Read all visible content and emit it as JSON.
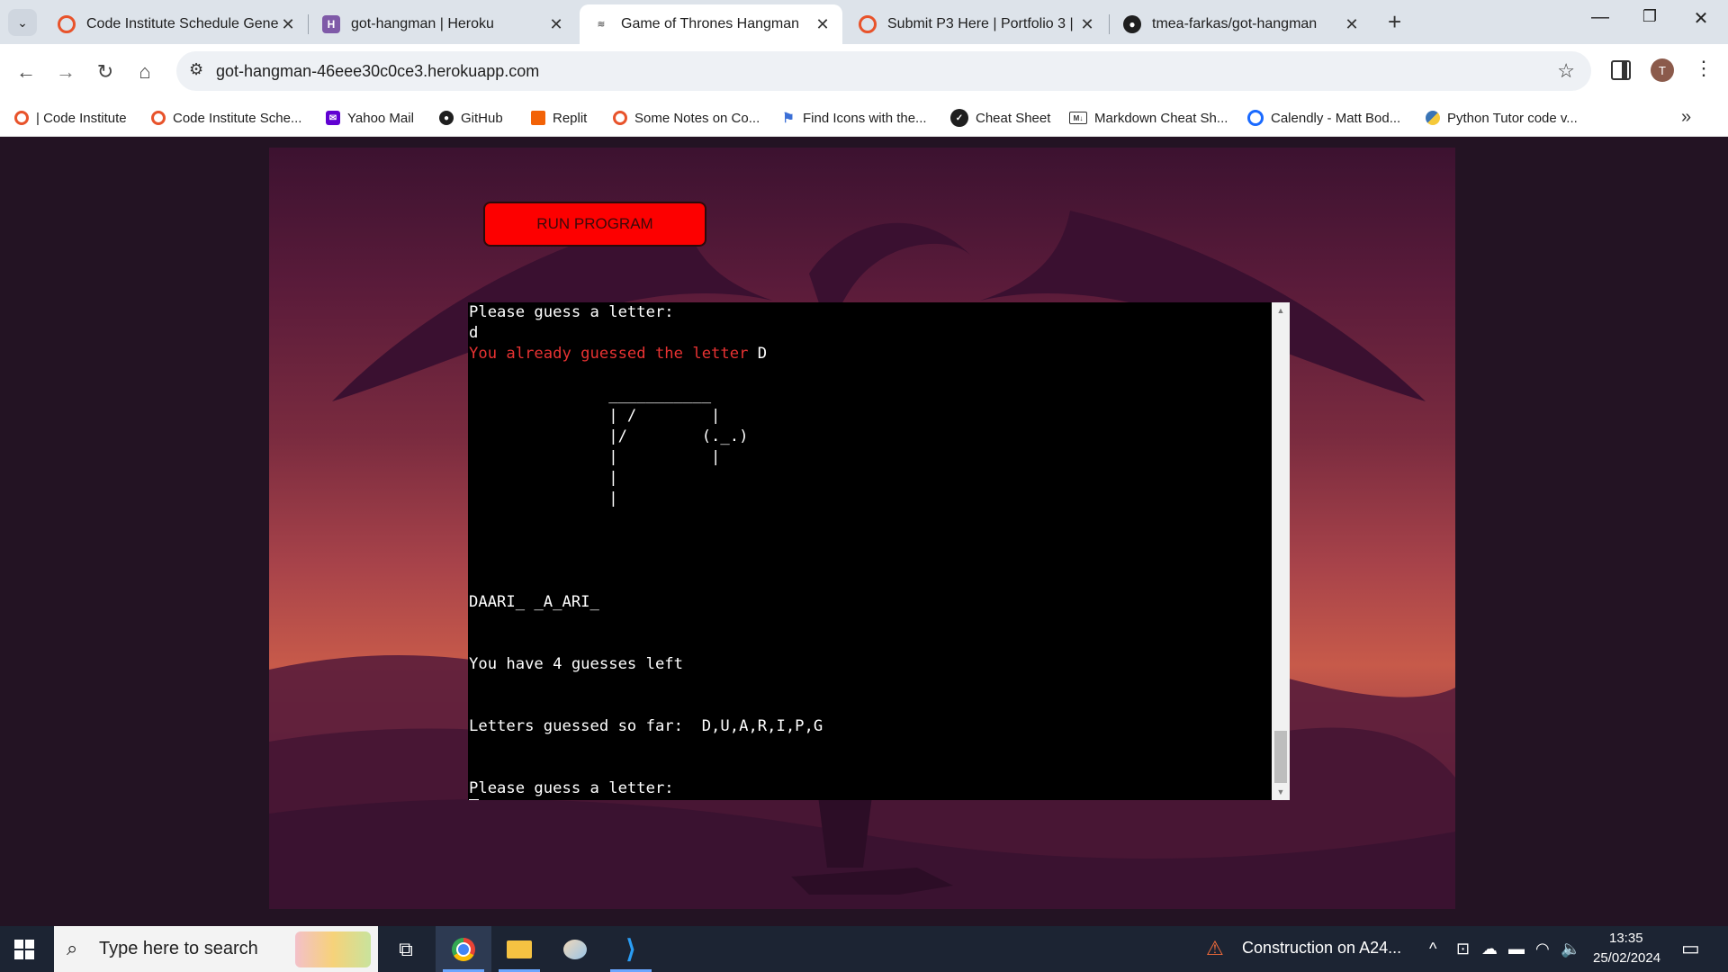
{
  "browser": {
    "tabs": [
      {
        "title": "Code Institute Schedule Genera",
        "favicon": "code-institute-icon",
        "active": false
      },
      {
        "title": "got-hangman | Heroku",
        "favicon": "heroku-icon",
        "active": false
      },
      {
        "title": "Game of Thrones Hangman",
        "favicon": "game-of-thrones-icon",
        "active": true
      },
      {
        "title": "Submit P3 Here | Portfolio 3 | Pl",
        "favicon": "code-institute-icon",
        "active": false
      },
      {
        "title": "tmea-farkas/got-hangman",
        "favicon": "github-icon",
        "active": false
      }
    ],
    "url": "got-hangman-46eee30c0ce3.herokuapp.com",
    "profile_initial": "T",
    "bookmarks": [
      {
        "label": "| Code Institute",
        "icon": "code-institute-icon"
      },
      {
        "label": "Code Institute Sche...",
        "icon": "code-institute-icon"
      },
      {
        "label": "Yahoo Mail",
        "icon": "yahoo-mail-icon"
      },
      {
        "label": "GitHub",
        "icon": "github-icon"
      },
      {
        "label": "Replit",
        "icon": "replit-icon"
      },
      {
        "label": "Some Notes on Co...",
        "icon": "code-institute-icon"
      },
      {
        "label": "Find Icons with the...",
        "icon": "flag-icon"
      },
      {
        "label": "Cheat Sheet",
        "icon": "cheat-sheet-icon"
      },
      {
        "label": "Markdown Cheat Sh...",
        "icon": "markdown-icon"
      },
      {
        "label": "Calendly - Matt Bod...",
        "icon": "calendly-icon"
      },
      {
        "label": "Python Tutor code v...",
        "icon": "python-icon"
      }
    ]
  },
  "page": {
    "run_button_label": "RUN PROGRAM",
    "terminal": {
      "prompt_1": "Please guess a letter:",
      "input_1": "d",
      "warning": "You already guessed the letter",
      "warning_letter": "D",
      "gallows": "\n               ___________\n               | /        |\n               |/        (._.)\n               |          |\n               |\n               |\n\n\n\n",
      "word": "DAARI_ _A_ARI_",
      "guesses_left": "You have 4 guesses left",
      "letters_label": "Letters guessed so far:",
      "letters": "D,U,A,R,I,P,G",
      "prompt_2": "Please guess a letter:"
    }
  },
  "taskbar": {
    "search_placeholder": "Type here to search",
    "apps": [
      "task-view-icon",
      "chrome-icon",
      "file-explorer-icon",
      "paint-icon",
      "vscode-icon"
    ],
    "notification": "Construction on A24...",
    "time": "13:35",
    "date": "25/02/2024"
  }
}
